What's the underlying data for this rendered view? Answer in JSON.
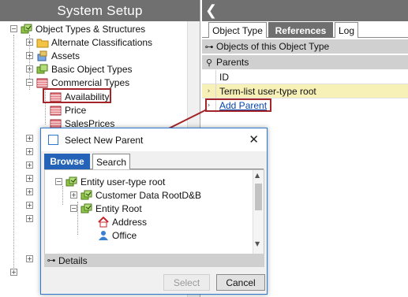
{
  "left_pane": {
    "title": "System Setup",
    "tree": {
      "object_types": "Object Types & Structures",
      "alternate_classifications": "Alternate Classifications",
      "assets": "Assets",
      "basic_object_types": "Basic Object Types",
      "commercial_types": "Commercial Types",
      "availability": "Availability",
      "price": "Price",
      "sales_prices": "SalesPrices"
    }
  },
  "right_pane": {
    "back_icon": "back-arrow-icon",
    "tabs": [
      "Object Type",
      "References",
      "Log"
    ],
    "active_tab": "References",
    "objects_section": "Objects of this  Object Type",
    "parents_section": "Parents",
    "rows": {
      "id": "ID",
      "termlist": "Term-list user-type root",
      "add_parent": "Add Parent"
    }
  },
  "dialog": {
    "title": "Select New Parent",
    "tabs": [
      "Browse",
      "Search"
    ],
    "tree": {
      "entity_root_type": "Entity user-type root",
      "customer_data": "Customer Data RootD&B",
      "entity_root": "Entity Root",
      "address": "Address",
      "office": "Office"
    },
    "details": "Details",
    "buttons": {
      "select": "Select",
      "cancel": "Cancel"
    }
  },
  "colors": {
    "header_gray": "#707070",
    "highlight_red": "#a3252a",
    "dialog_blue": "#2463b7",
    "link_blue": "#0645ad",
    "termlist_yellow": "#f7f1b8"
  }
}
